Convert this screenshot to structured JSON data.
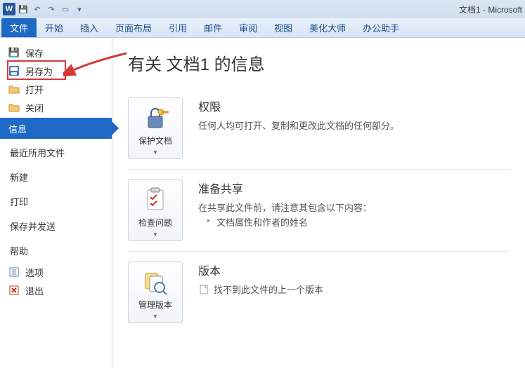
{
  "titlebar": {
    "app_letter": "W",
    "doc_title": "文档1 - Microsoft"
  },
  "ribbon": {
    "file": "文件",
    "tabs": [
      "开始",
      "插入",
      "页面布局",
      "引用",
      "邮件",
      "审阅",
      "视图",
      "美化大师",
      "办公助手"
    ]
  },
  "side": {
    "save": "保存",
    "save_as": "另存为",
    "open": "打开",
    "close": "关闭",
    "info": "信息",
    "recent": "最近所用文件",
    "new": "新建",
    "print": "打印",
    "save_send": "保存并发送",
    "help": "帮助",
    "options": "选项",
    "exit": "退出"
  },
  "content": {
    "title": "有关 文档1 的信息",
    "perm": {
      "btn": "保护文档",
      "heading": "权限",
      "line": "任何人均可打开、复制和更改此文档的任何部分。"
    },
    "share": {
      "btn": "检查问题",
      "heading": "准备共享",
      "line": "在共享此文件前，请注意其包含以下内容：",
      "bullet": "文档属性和作者的姓名"
    },
    "ver": {
      "btn": "管理版本",
      "heading": "版本",
      "line": "找不到此文件的上一个版本"
    }
  }
}
